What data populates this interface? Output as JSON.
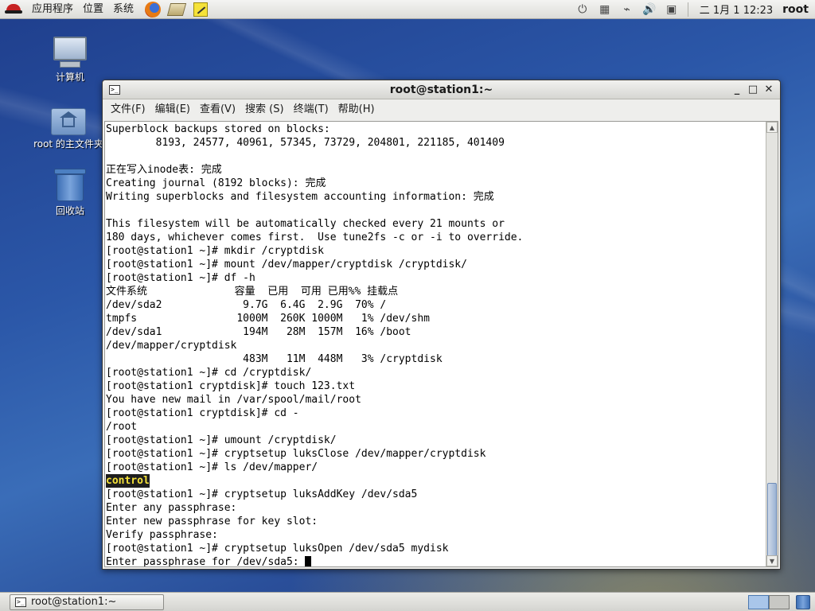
{
  "top_panel": {
    "menus": [
      "应用程序",
      "位置",
      "系统"
    ],
    "launchers": [
      "firefox-icon",
      "mail-icon",
      "notes-icon"
    ],
    "clock": "二 1月  1 12:23",
    "user": "root"
  },
  "desktop": {
    "icons": [
      {
        "label": "计算机",
        "icon": "computer-icon"
      },
      {
        "label": "root 的主文件夹",
        "icon": "home-folder-icon"
      },
      {
        "label": "回收站",
        "icon": "trash-icon"
      }
    ]
  },
  "window": {
    "title": "root@station1:~",
    "menu": [
      "文件(F)",
      "编辑(E)",
      "查看(V)",
      "搜索 (S)",
      "终端(T)",
      "帮助(H)"
    ],
    "terminal_lines": [
      "Superblock backups stored on blocks:",
      "        8193, 24577, 40961, 57345, 73729, 204801, 221185, 401409",
      "",
      "正在写入inode表: 完成",
      "Creating journal (8192 blocks): 完成",
      "Writing superblocks and filesystem accounting information: 完成",
      "",
      "This filesystem will be automatically checked every 21 mounts or",
      "180 days, whichever comes first.  Use tune2fs -c or -i to override.",
      "[root@station1 ~]# mkdir /cryptdisk",
      "[root@station1 ~]# mount /dev/mapper/cryptdisk /cryptdisk/",
      "[root@station1 ~]# df -h",
      "文件系统              容量  已用  可用 已用%% 挂载点",
      "/dev/sda2             9.7G  6.4G  2.9G  70% /",
      "tmpfs                1000M  260K 1000M   1% /dev/shm",
      "/dev/sda1             194M   28M  157M  16% /boot",
      "/dev/mapper/cryptdisk",
      "                      483M   11M  448M   3% /cryptdisk",
      "[root@station1 ~]# cd /cryptdisk/",
      "[root@station1 cryptdisk]# touch 123.txt",
      "You have new mail in /var/spool/mail/root",
      "[root@station1 cryptdisk]# cd -",
      "/root",
      "[root@station1 ~]# umount /cryptdisk/",
      "[root@station1 ~]# cryptsetup luksClose /dev/mapper/cryptdisk",
      "[root@station1 ~]# ls /dev/mapper/",
      "control",
      "[root@station1 ~]# cryptsetup luksAddKey /dev/sda5",
      "Enter any passphrase:",
      "Enter new passphrase for key slot:",
      "Verify passphrase:",
      "[root@station1 ~]# cryptsetup luksOpen /dev/sda5 mydisk",
      "Enter passphrase for /dev/sda5: "
    ],
    "highlighted_line_index": 26,
    "highlight_colors": {
      "bg": "#1e1e1e",
      "fg": "#f5e23a"
    }
  },
  "taskbar": {
    "task_label": "root@station1:~"
  }
}
